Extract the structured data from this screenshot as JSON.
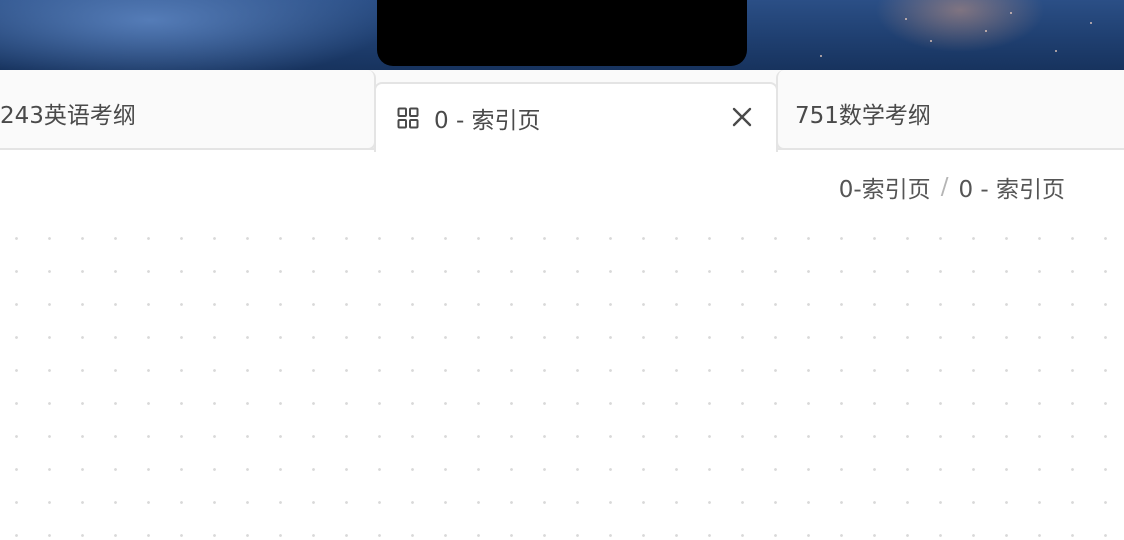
{
  "tabs": [
    {
      "label": "243英语考纲",
      "active": false
    },
    {
      "label": "0 - 索引页",
      "active": true,
      "icon": "grid-icon",
      "close_icon": "close-icon"
    },
    {
      "label": "751数学考纲",
      "active": false
    }
  ],
  "breadcrumb": {
    "items": [
      "0-索引页",
      "0 - 索引页"
    ],
    "separator": "/"
  },
  "colors": {
    "tab_border": "#e4e4e4",
    "text": "#4a4a4a",
    "dot_grid": "#d9d9d9"
  }
}
